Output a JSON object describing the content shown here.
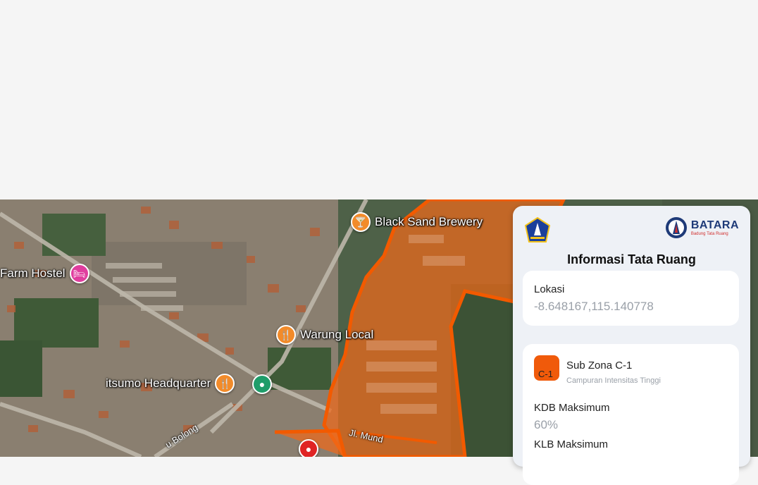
{
  "map": {
    "pois": [
      {
        "label": "Black Sand Brewery",
        "icon": "glass-icon"
      },
      {
        "label": "Farm Hostel",
        "icon": "bed-icon"
      },
      {
        "label": "Warung Local",
        "icon": "fork-knife-icon"
      },
      {
        "label": "itsumo Headquarter",
        "icon": "fork-knife-icon"
      },
      {
        "label": "",
        "icon": "location-pin-icon"
      }
    ],
    "roads": [
      "Jl. Mund",
      "u Bolong"
    ],
    "colors": {
      "zone_fill": "#f06a1a",
      "zone_stroke": "#f25a00",
      "pin_orange": "#f28b2a",
      "pin_pink": "#e03d9e",
      "pin_green": "#1f9d6a",
      "pin_red": "#e02424"
    }
  },
  "panel": {
    "brand": {
      "name": "BATARA",
      "sub": "Badung Tata Ruang"
    },
    "title": "Informasi Tata Ruang",
    "location": {
      "label": "Lokasi",
      "value": "-8.648167,115.140778"
    },
    "zone": {
      "badge": "C-1",
      "title": "Sub Zona C-1",
      "subtitle": "Campuran Intensitas Tinggi",
      "kdb_label": "KDB Maksimum",
      "kdb_value": "60%",
      "klb_label": "KLB Maksimum"
    }
  }
}
